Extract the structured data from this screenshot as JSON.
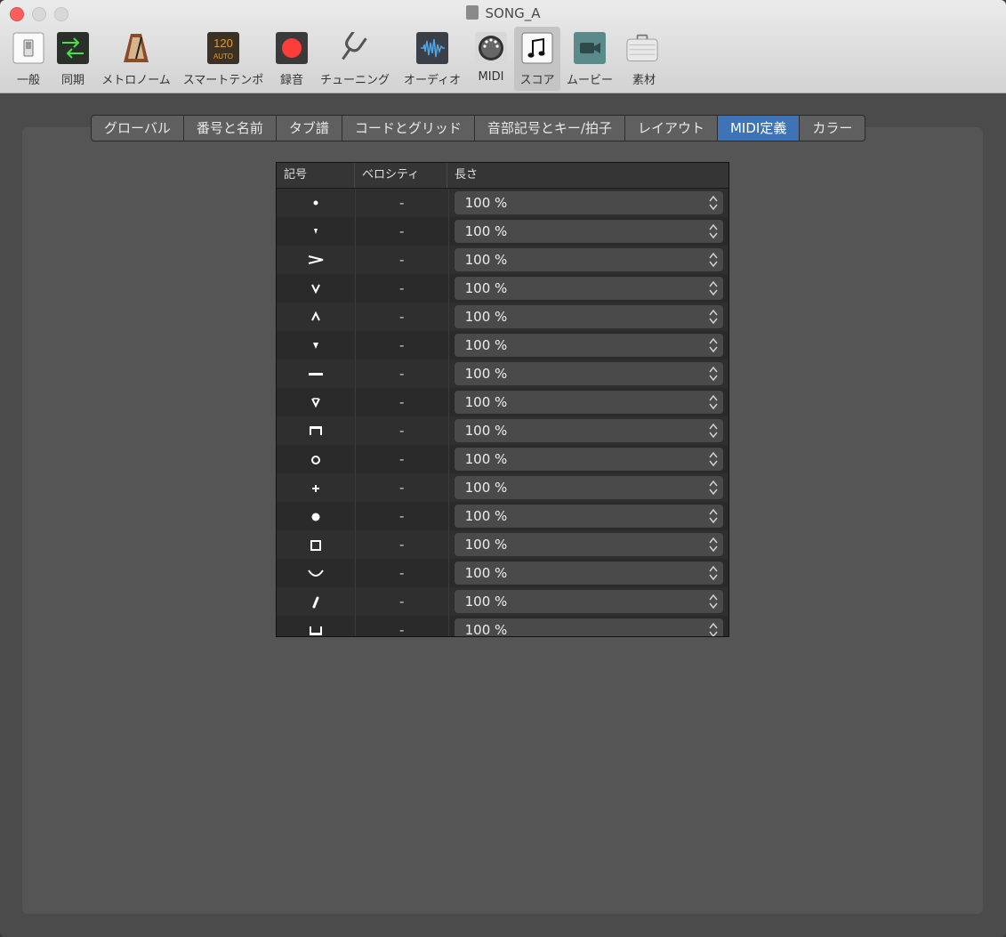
{
  "window": {
    "title": "SONG_A"
  },
  "toolbar": {
    "items": [
      {
        "label": "一般",
        "icon": "general-switch-icon"
      },
      {
        "label": "同期",
        "icon": "sync-arrows-icon"
      },
      {
        "label": "メトロノーム",
        "icon": "metronome-icon"
      },
      {
        "label": "スマートテンポ",
        "icon": "smart-tempo-icon",
        "icon_text_top": "120",
        "icon_text_bottom": "AUTO"
      },
      {
        "label": "録音",
        "icon": "record-icon"
      },
      {
        "label": "チューニング",
        "icon": "tuning-fork-icon"
      },
      {
        "label": "オーディオ",
        "icon": "audio-waveform-icon"
      },
      {
        "label": "MIDI",
        "icon": "midi-connector-icon"
      },
      {
        "label": "スコア",
        "icon": "score-note-icon",
        "selected": true
      },
      {
        "label": "ムービー",
        "icon": "movie-camera-icon"
      },
      {
        "label": "素材",
        "icon": "assets-briefcase-icon"
      }
    ]
  },
  "tabs": [
    {
      "label": "グローバル"
    },
    {
      "label": "番号と名前"
    },
    {
      "label": "タブ譜"
    },
    {
      "label": "コードとグリッド"
    },
    {
      "label": "音部記号とキー/拍子"
    },
    {
      "label": "レイアウト"
    },
    {
      "label": "MIDI定義",
      "active": true
    },
    {
      "label": "カラー"
    }
  ],
  "table": {
    "headers": {
      "symbol": "記号",
      "velocity": "ベロシティ",
      "length": "長さ"
    },
    "rows": [
      {
        "symbol": "staccato-dot-icon",
        "velocity": "-",
        "length": "100 %"
      },
      {
        "symbol": "staccatissimo-wedge-icon",
        "velocity": "-",
        "length": "100 %"
      },
      {
        "symbol": "accent-icon",
        "velocity": "-",
        "length": "100 %"
      },
      {
        "symbol": "marcato-down-icon",
        "velocity": "-",
        "length": "100 %"
      },
      {
        "symbol": "marcato-up-icon",
        "velocity": "-",
        "length": "100 %"
      },
      {
        "symbol": "spiccato-wedge-icon",
        "velocity": "-",
        "length": "100 %"
      },
      {
        "symbol": "tenuto-icon",
        "velocity": "-",
        "length": "100 %"
      },
      {
        "symbol": "marcato-tenuto-icon",
        "velocity": "-",
        "length": "100 %"
      },
      {
        "symbol": "down-bow-icon",
        "velocity": "-",
        "length": "100 %"
      },
      {
        "symbol": "harmonic-circle-icon",
        "velocity": "-",
        "length": "100 %"
      },
      {
        "symbol": "stopped-plus-icon",
        "velocity": "-",
        "length": "100 %"
      },
      {
        "symbol": "filled-dot-icon",
        "velocity": "-",
        "length": "100 %"
      },
      {
        "symbol": "square-icon",
        "velocity": "-",
        "length": "100 %"
      },
      {
        "symbol": "arc-icon",
        "velocity": "-",
        "length": "100 %"
      },
      {
        "symbol": "breath-mark-icon",
        "velocity": "-",
        "length": "100 %"
      },
      {
        "symbol": "open-box-icon",
        "velocity": "-",
        "length": "100 %"
      }
    ]
  },
  "colors": {
    "active_tab": "#3e74b6",
    "record": "#fc3d39",
    "tempo_orange": "#f09a1a"
  }
}
